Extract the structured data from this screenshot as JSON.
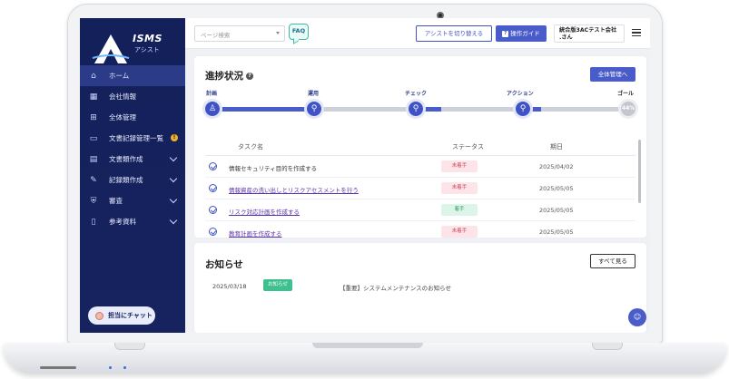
{
  "sidebar": {
    "logo_title": "ISMS",
    "logo_sub": "アシスト",
    "items": [
      {
        "label": "ホーム",
        "icon": "home-icon",
        "glyph": "⌂",
        "active": true
      },
      {
        "label": "会社情報",
        "icon": "building-icon",
        "glyph": "▦"
      },
      {
        "label": "全体管理",
        "icon": "grid-icon",
        "glyph": "⊞"
      },
      {
        "label": "文書記録管理一覧",
        "icon": "folder-icon",
        "glyph": "▭",
        "badge": "!"
      },
      {
        "label": "文書類作成",
        "icon": "document-icon",
        "glyph": "▤",
        "expandable": true
      },
      {
        "label": "記録類作成",
        "icon": "pen-icon",
        "glyph": "✎",
        "expandable": true
      },
      {
        "label": "審査",
        "icon": "shield-icon",
        "glyph": "⛨",
        "expandable": true
      },
      {
        "label": "参考資料",
        "icon": "book-icon",
        "glyph": "▯",
        "expandable": true
      }
    ],
    "chat_label": "担当にチャット"
  },
  "topbar": {
    "search_placeholder": "ページ検索",
    "faq_label": "FAQ",
    "assist_toggle_label": "アシストを切り替える",
    "guide_label": "操作ガイド",
    "company_line1": "統合版3ACテスト会社",
    "company_line2": ".さん"
  },
  "progress": {
    "title": "進捗状況",
    "overall_button": "全体管理へ",
    "stages": [
      "計画",
      "運用",
      "チェック",
      "アクション",
      "ゴール"
    ],
    "goal_percent": "44%",
    "table": {
      "headers": [
        "タスク名",
        "ステータス",
        "期日"
      ],
      "rows": [
        {
          "name": "情報セキュリティ目的を作成する",
          "status": "未着手",
          "status_type": "todo",
          "date": "2025/04/02",
          "link": false
        },
        {
          "name": "情報資産の洗い出しとリスクアセスメントを行う",
          "status": "未着手",
          "status_type": "todo",
          "date": "2025/05/05",
          "link": true
        },
        {
          "name": "リスク対応計画を作成する",
          "status": "着手",
          "status_type": "doing",
          "date": "2025/05/05",
          "link": true
        },
        {
          "name": "教育計画を作成する",
          "status": "未着手",
          "status_type": "todo",
          "date": "2025/05/05",
          "link": true
        }
      ]
    }
  },
  "notice": {
    "title": "お知らせ",
    "see_all": "すべて見る",
    "items": [
      {
        "date": "2025/03/18",
        "badge": "お知らせ",
        "text": "【重要】システムメンテナンスのお知らせ"
      }
    ]
  },
  "colors": {
    "sidebar_bg": "#14205a",
    "accent": "#4a5cc9",
    "todo": "#d0455f",
    "doing": "#2e9d64"
  }
}
